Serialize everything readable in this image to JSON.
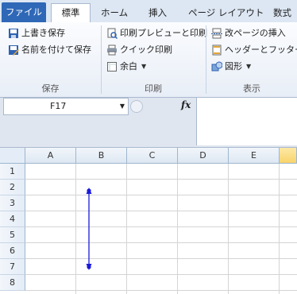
{
  "tabs": [
    {
      "label": "ファイル",
      "active": false
    },
    {
      "label": "標準",
      "active": true
    },
    {
      "label": "ホーム",
      "active": false
    },
    {
      "label": "挿入",
      "active": false
    },
    {
      "label": "ページ レイアウト",
      "active": false
    },
    {
      "label": "数式",
      "active": false
    }
  ],
  "ribbon": {
    "save_group": {
      "label": "保存",
      "items": [
        {
          "label": "上書き保存",
          "icon": "save-icon"
        },
        {
          "label": "名前を付けて保存",
          "icon": "save-as-icon"
        }
      ]
    },
    "print_group": {
      "label": "印刷",
      "items": [
        {
          "label": "印刷プレビューと印刷",
          "icon": "print-preview-icon"
        },
        {
          "label": "クイック印刷",
          "icon": "quick-print-icon"
        },
        {
          "label": "余白",
          "icon": "margins-icon",
          "dropdown": true
        }
      ]
    },
    "view_group": {
      "label": "表示",
      "items": [
        {
          "label": "改ページの挿入",
          "icon": "page-break-icon"
        },
        {
          "label": "ヘッダーとフッター",
          "icon": "header-footer-icon"
        },
        {
          "label": "図形",
          "icon": "shapes-icon",
          "dropdown": true
        }
      ]
    }
  },
  "formula_bar": {
    "name_box": "F17",
    "fx": "fx",
    "formula": ""
  },
  "sheet": {
    "columns": [
      "A",
      "B",
      "C",
      "D",
      "E",
      ""
    ],
    "rows": [
      "1",
      "2",
      "3",
      "4",
      "5",
      "6",
      "7",
      "8"
    ],
    "shape": {
      "type": "double-arrow-line",
      "color": "#0000cc",
      "from_cell": "B2",
      "to_cell": "B7"
    }
  },
  "colors": {
    "file_tab": "#2f68b7",
    "selected_column_header": "#f8d36a",
    "arrow": "#1a1adb"
  }
}
